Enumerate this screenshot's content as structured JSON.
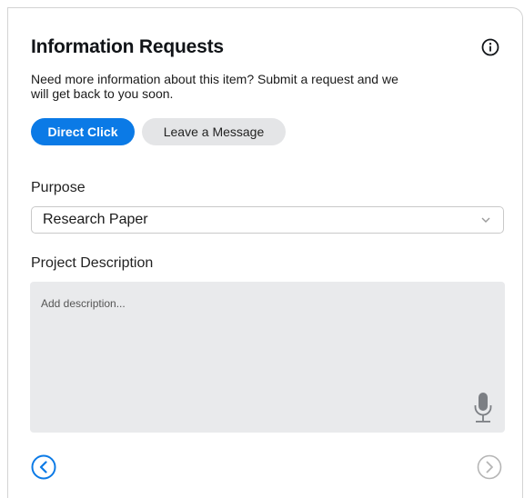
{
  "header": {
    "title": "Information Requests",
    "subtitle": "Need more information about this item? Submit a request and we will get back to you soon.",
    "info_icon": "info-circle-icon"
  },
  "tabs": [
    {
      "label": "Direct Click",
      "active": true
    },
    {
      "label": "Leave a Message",
      "active": false
    }
  ],
  "form": {
    "purpose": {
      "label": "Purpose",
      "selected": "Research Paper",
      "icon": "chevron-down-icon"
    },
    "description": {
      "label": "Project Description",
      "placeholder": "Add description...",
      "value": "",
      "icon": "microphone-icon"
    }
  },
  "navigation": {
    "prev_icon": "chevron-left-circle-icon",
    "next_icon": "chevron-right-circle-icon"
  },
  "colors": {
    "accent": "#0b7ae6",
    "tab_inactive": "#e4e5e7",
    "textarea_bg": "#e9eaec",
    "disabled": "#b5b5b5"
  }
}
